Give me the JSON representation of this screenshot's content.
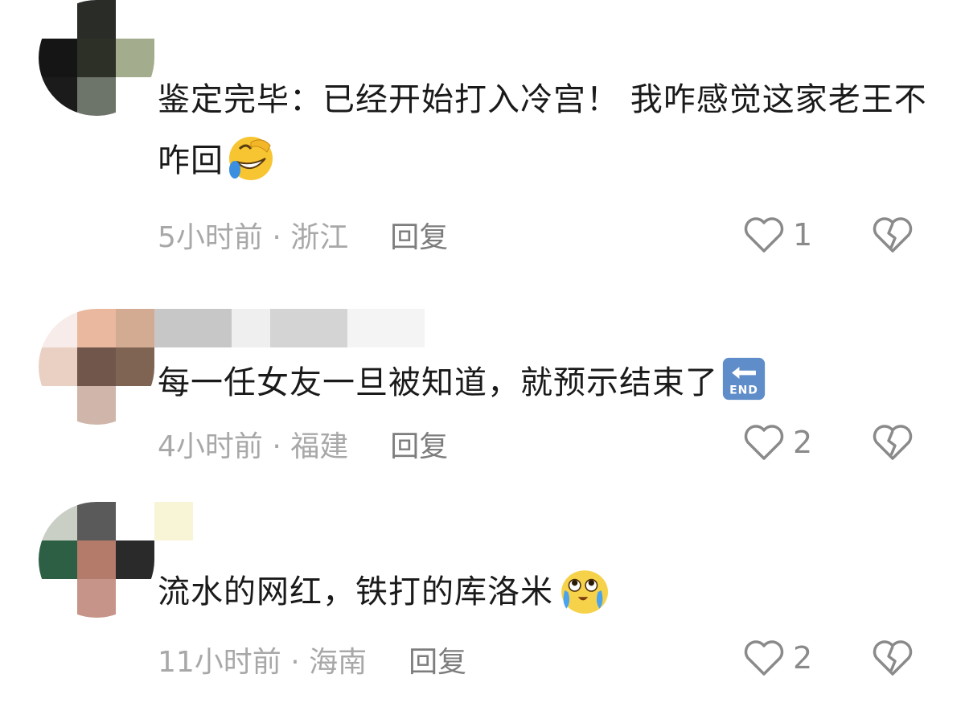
{
  "comments": [
    {
      "text": "鉴定完毕：已经开始打入冷宫！ 我咋感觉这家老王不咋回",
      "emoji": "rofl-emoji",
      "time": "5小时前",
      "location": "浙江",
      "reply_label": "回复",
      "likes": "1"
    },
    {
      "text": "每一任女友一旦被知道，就预示结束了",
      "emoji": "end-arrow-emoji",
      "time": "4小时前",
      "location": "福建",
      "reply_label": "回复",
      "likes": "2"
    },
    {
      "text": "流水的网红，铁打的库洛米",
      "emoji": "crying-face-emoji",
      "time": "11小时前",
      "location": "海南",
      "reply_label": "回复",
      "likes": "2"
    }
  ],
  "meta_separator": " · ",
  "colors": {
    "text": "#1a1a1a",
    "meta": "#a8a8a8",
    "reply": "#7d7d7d",
    "icon": "#8a8a8a"
  }
}
